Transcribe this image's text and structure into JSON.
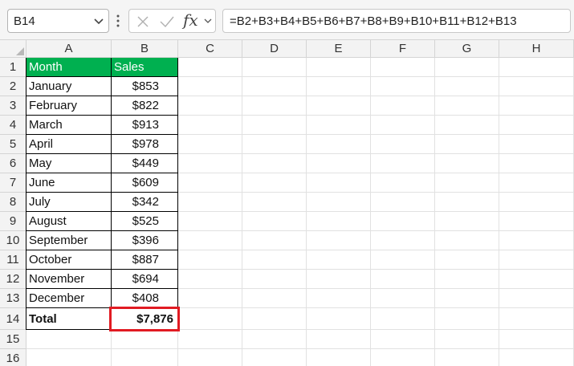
{
  "formula_bar": {
    "name_box": "B14",
    "function_label": "fx",
    "formula": "=B2+B3+B4+B5+B6+B7+B8+B9+B10+B11+B12+B13"
  },
  "columns": [
    "A",
    "B",
    "C",
    "D",
    "E",
    "F",
    "G",
    "H"
  ],
  "rows": [
    "1",
    "2",
    "3",
    "4",
    "5",
    "6",
    "7",
    "8",
    "9",
    "10",
    "11",
    "12",
    "13",
    "14",
    "15",
    "16"
  ],
  "table": {
    "header": {
      "month": "Month",
      "sales": "Sales"
    },
    "data": [
      {
        "month": "January",
        "sales": "$853"
      },
      {
        "month": "February",
        "sales": "$822"
      },
      {
        "month": "March",
        "sales": "$913"
      },
      {
        "month": "April",
        "sales": "$978"
      },
      {
        "month": "May",
        "sales": "$449"
      },
      {
        "month": "June",
        "sales": "$609"
      },
      {
        "month": "July",
        "sales": "$342"
      },
      {
        "month": "August",
        "sales": "$525"
      },
      {
        "month": "September",
        "sales": "$396"
      },
      {
        "month": "October",
        "sales": "$887"
      },
      {
        "month": "November",
        "sales": "$694"
      },
      {
        "month": "December",
        "sales": "$408"
      }
    ],
    "total": {
      "label": "Total",
      "value": "$7,876"
    }
  },
  "colors": {
    "header_fill": "#00b050",
    "selection_border": "#e11b22"
  },
  "icons": {
    "namebox_dropdown": "chevron-down-icon",
    "more": "vertical-dots-icon",
    "cancel": "close-icon",
    "enter": "check-icon",
    "function_dropdown": "chevron-down-icon"
  }
}
